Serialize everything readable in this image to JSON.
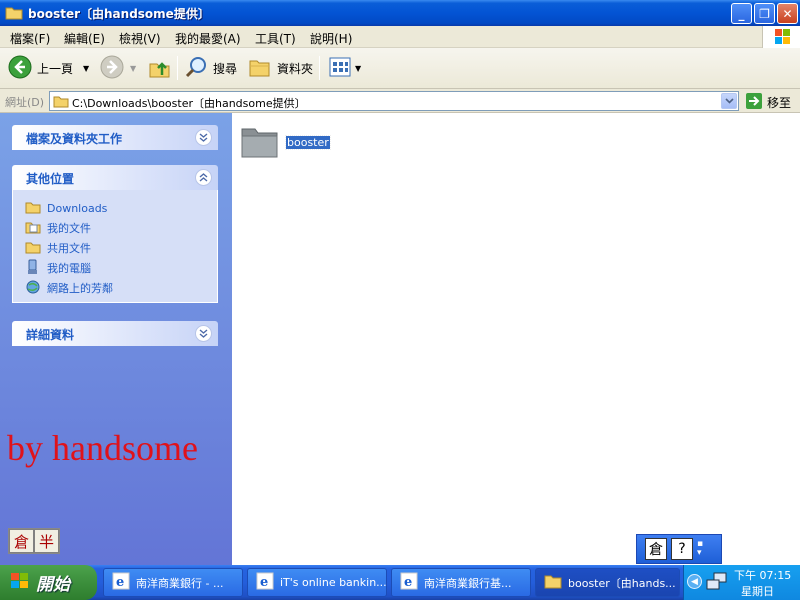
{
  "window": {
    "title": "booster〔由handsome提供〕",
    "buttons": {
      "minimize": "_",
      "maximize": "❐",
      "close": "✕"
    }
  },
  "menubar": {
    "items": [
      "檔案(F)",
      "編輯(E)",
      "檢視(V)",
      "我的最愛(A)",
      "工具(T)",
      "說明(H)"
    ]
  },
  "toolbar": {
    "back_label": "上一頁",
    "search_label": "搜尋",
    "folders_label": "資料夾"
  },
  "address": {
    "label": "網址(D)",
    "value": "C:\\Downloads\\booster〔由handsome提供〕",
    "go_label": "移至"
  },
  "leftpane": {
    "panel1_title": "檔案及資料夾工作",
    "panel2_title": "其他位置",
    "other_places": [
      "Downloads",
      "我的文件",
      "共用文件",
      "我的電腦",
      "網路上的芳鄰"
    ],
    "panel3_title": "詳細資料",
    "watermark": "by handsome",
    "ime_keys": [
      "倉",
      "半"
    ]
  },
  "content": {
    "items": [
      {
        "name": "booster",
        "selected": true
      }
    ]
  },
  "langbar": {
    "keys": [
      "倉",
      "?"
    ]
  },
  "taskbar": {
    "start_label": "開始",
    "tasks": [
      {
        "label": "南洋商業銀行 - ...",
        "active": false,
        "icon": "ie-icon"
      },
      {
        "label": "iT's online bankin...",
        "active": false,
        "icon": "ie-icon"
      },
      {
        "label": "南洋商業銀行基...",
        "active": false,
        "icon": "ie-icon"
      },
      {
        "label": "booster〔由hands...",
        "active": true,
        "icon": "folder-icon"
      }
    ],
    "clock_time": "下午 07:15",
    "clock_day": "星期日"
  },
  "colors": {
    "titlebar": "#0354d4",
    "leftpane_top": "#7ba2e7",
    "leftpane_bottom": "#6375d6",
    "link": "#215dc6",
    "watermark": "#e0121a",
    "selection": "#316ac5"
  }
}
